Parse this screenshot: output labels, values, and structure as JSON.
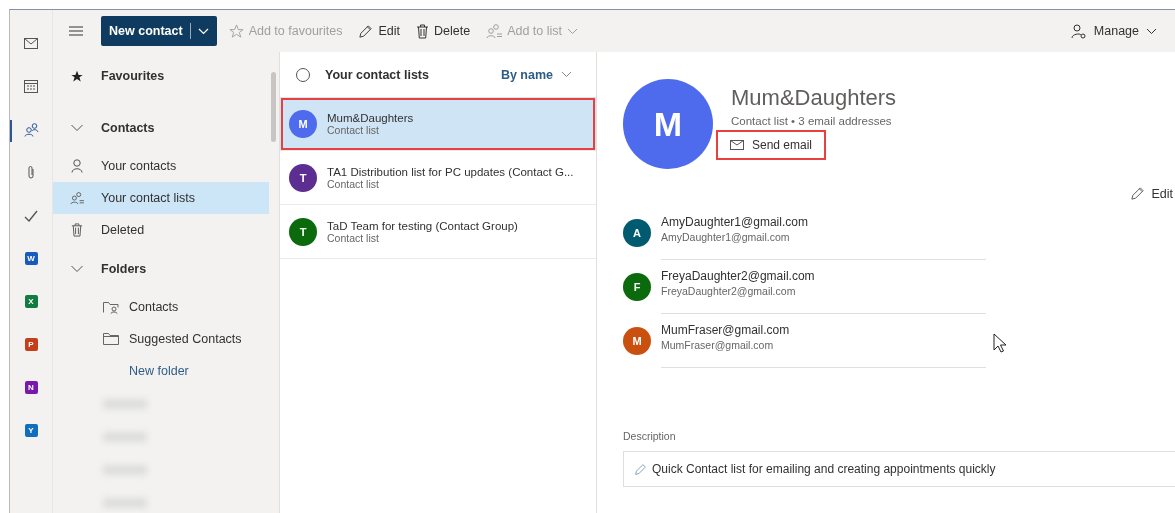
{
  "rail": [
    {
      "kind": "mail",
      "selected": false
    },
    {
      "kind": "calendar",
      "selected": false
    },
    {
      "kind": "people",
      "selected": true
    },
    {
      "kind": "attach",
      "selected": false
    },
    {
      "kind": "todo",
      "selected": false
    },
    {
      "kind": "app",
      "letter": "W",
      "color": "#185abd",
      "selected": false
    },
    {
      "kind": "app",
      "letter": "X",
      "color": "#107c41",
      "selected": false
    },
    {
      "kind": "app",
      "letter": "P",
      "color": "#c43e1c",
      "selected": false
    },
    {
      "kind": "app",
      "letter": "N",
      "color": "#7719aa",
      "selected": false
    },
    {
      "kind": "app",
      "letter": "Y",
      "color": "#106ebe",
      "selected": false
    }
  ],
  "toolbar": {
    "new_contact": "New contact",
    "actions": [
      {
        "kind": "star",
        "label": "Add to favourites",
        "disabled": true
      },
      {
        "kind": "edit",
        "label": "Edit",
        "disabled": false
      },
      {
        "kind": "delete",
        "label": "Delete",
        "disabled": false
      },
      {
        "kind": "addlist",
        "label": "Add to list",
        "disabled": true
      }
    ],
    "manage": "Manage"
  },
  "sidebar": {
    "items": [
      {
        "kind": "star",
        "label": "Favourites",
        "selected": false
      },
      {
        "kind": "chevron",
        "label": "Contacts",
        "selected": false
      },
      {
        "kind": "person",
        "label": "Your contacts",
        "selected": false
      },
      {
        "kind": "lists",
        "label": "Your contact lists",
        "selected": true
      },
      {
        "kind": "trash",
        "label": "Deleted",
        "selected": false
      },
      {
        "kind": "chevron",
        "label": "Folders",
        "selected": false
      },
      {
        "kind": "folder-person",
        "label": "Contacts",
        "selected": false
      },
      {
        "kind": "folder",
        "label": "Suggested Contacts",
        "selected": false
      },
      {
        "kind": "link",
        "label": "New folder",
        "selected": false
      },
      {
        "kind": "blurred"
      },
      {
        "kind": "blurred"
      },
      {
        "kind": "blurred"
      },
      {
        "kind": "blurred"
      }
    ]
  },
  "list": {
    "select_all_checked": false,
    "title": "Your contact lists",
    "sort": "By name",
    "items": [
      {
        "initial": "M",
        "color": "#4f6bed",
        "name": "Mum&Daughters",
        "type": "Contact list",
        "selected": true,
        "highlighted": true
      },
      {
        "initial": "T",
        "color": "#5c2e91",
        "name": "TA1 Distribution list for PC updates (Contact G...",
        "type": "Contact list",
        "selected": false,
        "highlighted": false
      },
      {
        "initial": "T",
        "color": "#0b6a0b",
        "name": "TaD Team for testing (Contact Group)",
        "type": "Contact list",
        "selected": false,
        "highlighted": false
      }
    ]
  },
  "detail": {
    "initial": "M",
    "color": "#4f6bed",
    "name": "Mum&Daughters",
    "subtitle": "Contact list • 3 email addresses",
    "send_email": {
      "label": "Send email",
      "highlighted": true
    },
    "edit": "Edit",
    "members": [
      {
        "initial": "A",
        "color": "#005b70",
        "name": "AmyDaughter1@gmail.com",
        "email": "AmyDaughter1@gmail.com"
      },
      {
        "initial": "F",
        "color": "#0b6a0b",
        "name": "FreyaDaughter2@gmail.com",
        "email": "FreyaDaughter2@gmail.com"
      },
      {
        "initial": "M",
        "color": "#ca5010",
        "name": "MumFraser@gmail.com",
        "email": "MumFraser@gmail.com"
      }
    ],
    "description_label": "Description",
    "description": "Quick Contact list for emailing and creating appointments quickly"
  }
}
